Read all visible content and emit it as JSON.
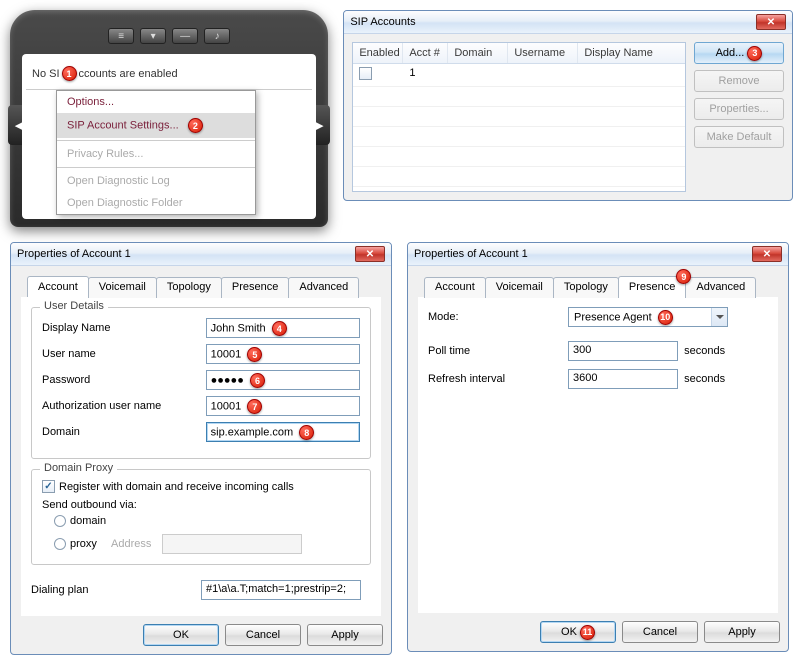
{
  "pda": {
    "status_prefix": "No SI",
    "status_suffix": "ccounts are enabled",
    "menu": {
      "options": "Options...",
      "sip": "SIP Account Settings...",
      "privacy": "Privacy Rules...",
      "diag_log": "Open Diagnostic Log",
      "diag_folder": "Open Diagnostic Folder"
    }
  },
  "sip": {
    "title": "SIP Accounts",
    "cols": {
      "enabled": "Enabled",
      "acct": "Acct #",
      "domain": "Domain",
      "username": "Username",
      "display": "Display Name"
    },
    "row1_acct": "1",
    "btns": {
      "add": "Add...",
      "remove": "Remove",
      "properties": "Properties...",
      "makedefault": "Make Default"
    }
  },
  "prop1": {
    "title": "Properties of Account 1",
    "tabs": {
      "account": "Account",
      "voicemail": "Voicemail",
      "topology": "Topology",
      "presence": "Presence",
      "advanced": "Advanced"
    },
    "user_details_legend": "User Details",
    "labels": {
      "display_name": "Display Name",
      "user_name": "User name",
      "password": "Password",
      "auth": "Authorization user name",
      "domain": "Domain"
    },
    "values": {
      "display_name": "John Smith",
      "user_name": "10001",
      "password": "●●●●●",
      "auth": "10001",
      "domain": "sip.example.com"
    },
    "proxy": {
      "legend": "Domain Proxy",
      "register": "Register with domain and receive incoming calls",
      "send_via": "Send outbound via:",
      "domain": "domain",
      "proxy": "proxy",
      "address": "Address"
    },
    "dialing_plan_label": "Dialing plan",
    "dialing_plan_value": "#1\\a\\a.T;match=1;prestrip=2;",
    "ok": "OK",
    "cancel": "Cancel",
    "apply": "Apply"
  },
  "prop2": {
    "title": "Properties of Account 1",
    "labels": {
      "mode": "Mode:",
      "poll": "Poll time",
      "refresh": "Refresh interval",
      "seconds": "seconds"
    },
    "values": {
      "mode": "Presence Agent",
      "poll": "300",
      "refresh": "3600"
    },
    "ok": "OK",
    "cancel": "Cancel",
    "apply": "Apply"
  },
  "markers": {
    "m1": "1",
    "m2": "2",
    "m3": "3",
    "m4": "4",
    "m5": "5",
    "m6": "6",
    "m7": "7",
    "m8": "8",
    "m9": "9",
    "m10": "10",
    "m11": "11"
  }
}
